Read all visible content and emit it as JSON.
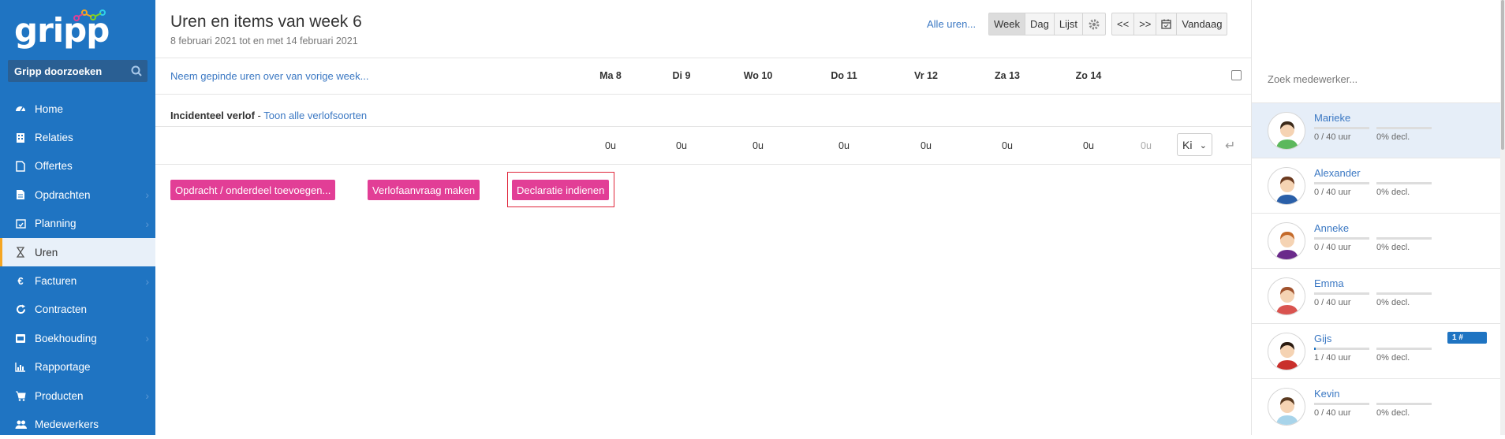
{
  "sidebar": {
    "logo_text": "gripp",
    "search_label": "Gripp doorzoeken",
    "items": [
      {
        "label": "Home",
        "icon": "dashboard-icon",
        "chevron": false
      },
      {
        "label": "Relaties",
        "icon": "building-icon",
        "chevron": false
      },
      {
        "label": "Offertes",
        "icon": "document-icon",
        "chevron": false
      },
      {
        "label": "Opdrachten",
        "icon": "file-icon",
        "chevron": true
      },
      {
        "label": "Planning",
        "icon": "calendar-check-icon",
        "chevron": true
      },
      {
        "label": "Uren",
        "icon": "hourglass-icon",
        "chevron": false,
        "active": true
      },
      {
        "label": "Facturen",
        "icon": "euro-icon",
        "chevron": true
      },
      {
        "label": "Contracten",
        "icon": "refresh-icon",
        "chevron": false
      },
      {
        "label": "Boekhouding",
        "icon": "bank-icon",
        "chevron": true
      },
      {
        "label": "Rapportage",
        "icon": "bar-chart-icon",
        "chevron": false
      },
      {
        "label": "Producten",
        "icon": "cart-icon",
        "chevron": true
      },
      {
        "label": "Medewerkers",
        "icon": "users-icon",
        "chevron": false
      }
    ]
  },
  "header": {
    "title": "Uren en items van week 6",
    "subtitle": "8 februari 2021 tot en met 14 februari 2021",
    "alle_uren": "Alle uren...",
    "view_buttons": {
      "week": "Week",
      "dag": "Dag",
      "lijst": "Lijst"
    },
    "nav_buttons": {
      "prev": "<<",
      "next": ">>",
      "today": "Vandaag"
    }
  },
  "week": {
    "pinned_link": "Neem gepinde uren over van vorige week...",
    "days": [
      "Ma 8",
      "Di 9",
      "Wo 10",
      "Do 11",
      "Vr 12",
      "Za 13",
      "Zo 14"
    ]
  },
  "verlof": {
    "title": "Incidenteel verlof",
    "separator": " - ",
    "link": "Toon alle verlofsoorten",
    "hours": [
      "0u",
      "0u",
      "0u",
      "0u",
      "0u",
      "0u",
      "0u"
    ],
    "total": "0u",
    "select_value": "Ki"
  },
  "actions": {
    "add_task": "Opdracht / onderdeel toevoegen...",
    "leave_request": "Verlofaanvraag maken",
    "declaration": "Declaratie indienen"
  },
  "employees": {
    "search_placeholder": "Zoek medewerker...",
    "list": [
      {
        "name": "Marieke",
        "hours": "0 / 40 uur",
        "decl": "0% decl.",
        "hours_fraction": 0,
        "selected": true
      },
      {
        "name": "Alexander",
        "hours": "0 / 40 uur",
        "decl": "0% decl.",
        "hours_fraction": 0
      },
      {
        "name": "Anneke",
        "hours": "0 / 40 uur",
        "decl": "0% decl.",
        "hours_fraction": 0
      },
      {
        "name": "Emma",
        "hours": "0 / 40 uur",
        "decl": "0% decl.",
        "hours_fraction": 0
      },
      {
        "name": "Gijs",
        "hours": "1 / 40 uur",
        "decl": "0% decl.",
        "hours_fraction": 0.025,
        "badge": "1 #"
      },
      {
        "name": "Kevin",
        "hours": "0 / 40 uur",
        "decl": "0% decl.",
        "hours_fraction": 0
      }
    ]
  },
  "colors": {
    "sidebar": "#1f74c2",
    "accent_pink": "#e23e96",
    "link": "#3b78c3",
    "highlight": "#e0263b"
  }
}
